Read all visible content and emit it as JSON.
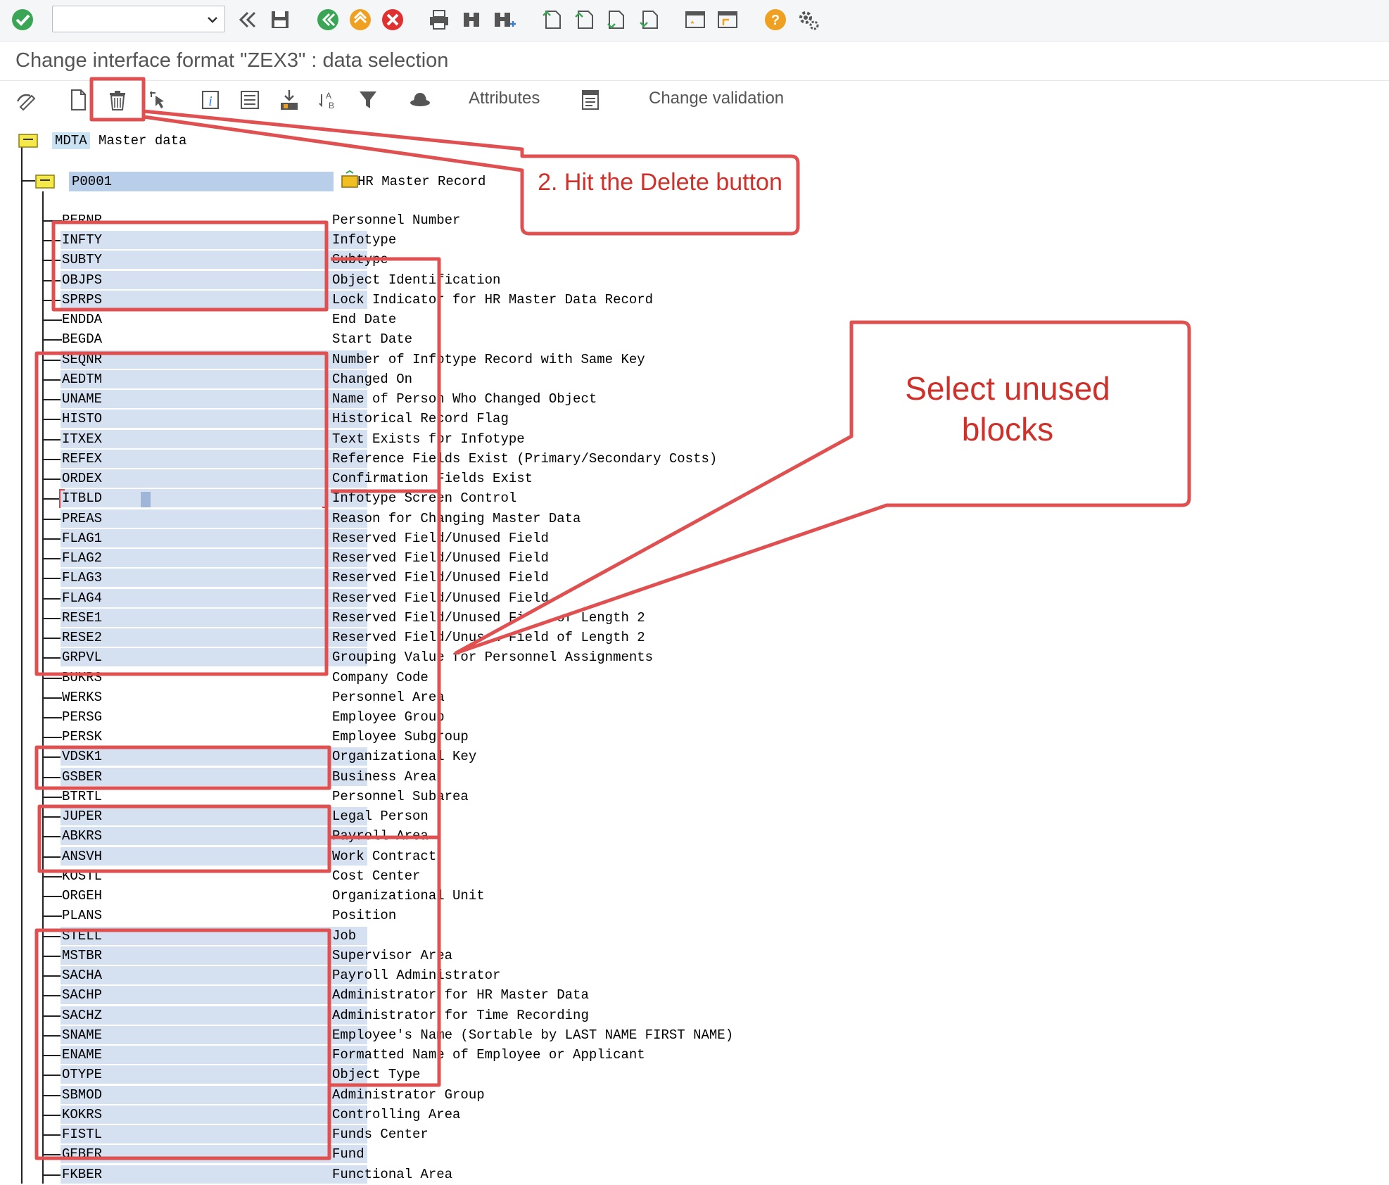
{
  "toolbar": {
    "command_value": "",
    "icons": [
      "enter-icon",
      "back-icon",
      "save-icon",
      "back-green-icon",
      "exit-icon",
      "cancel-icon",
      "print-icon",
      "find-icon",
      "find-next-icon",
      "first-page-icon",
      "previous-page-icon",
      "next-page-icon",
      "last-page-icon",
      "create-session-icon",
      "shortcut-icon",
      "help-icon",
      "settings-icon"
    ]
  },
  "title": "Change interface format \"ZEX3\" : data selection",
  "apptoolbar": {
    "attributes_label": "Attributes",
    "change_validation_label": "Change validation"
  },
  "tree": {
    "root": {
      "key": "MDTA",
      "label": "Master data"
    },
    "segment": {
      "key": "P0001",
      "label": "HR Master Record"
    },
    "fields": [
      {
        "name": "PERNR",
        "desc": "Personnel Number",
        "selected": false
      },
      {
        "name": "INFTY",
        "desc": "Infotype",
        "selected": true
      },
      {
        "name": "SUBTY",
        "desc": "Subtype",
        "selected": true
      },
      {
        "name": "OBJPS",
        "desc": "Object Identification",
        "selected": true
      },
      {
        "name": "SPRPS",
        "desc": "Lock Indicator for HR Master Data Record",
        "selected": true
      },
      {
        "name": "ENDDA",
        "desc": "End Date",
        "selected": false
      },
      {
        "name": "BEGDA",
        "desc": "Start Date",
        "selected": false
      },
      {
        "name": "SEQNR",
        "desc": "Number of Infotype Record with Same Key",
        "selected": true
      },
      {
        "name": "AEDTM",
        "desc": "Changed On",
        "selected": true
      },
      {
        "name": "UNAME",
        "desc": "Name of Person Who Changed Object",
        "selected": true
      },
      {
        "name": "HISTO",
        "desc": "Historical Record Flag",
        "selected": true
      },
      {
        "name": "ITXEX",
        "desc": "Text Exists for Infotype",
        "selected": true
      },
      {
        "name": "REFEX",
        "desc": "Reference Fields Exist (Primary/Secondary Costs)",
        "selected": true
      },
      {
        "name": "ORDEX",
        "desc": "Confirmation Fields Exist",
        "selected": true
      },
      {
        "name": "ITBLD",
        "desc": "Infotype Screen Control",
        "selected": true
      },
      {
        "name": "PREAS",
        "desc": "Reason for Changing Master Data",
        "selected": true
      },
      {
        "name": "FLAG1",
        "desc": "Reserved Field/Unused Field",
        "selected": true
      },
      {
        "name": "FLAG2",
        "desc": "Reserved Field/Unused Field",
        "selected": true
      },
      {
        "name": "FLAG3",
        "desc": "Reserved Field/Unused Field",
        "selected": true
      },
      {
        "name": "FLAG4",
        "desc": "Reserved Field/Unused Field",
        "selected": true
      },
      {
        "name": "RESE1",
        "desc": "Reserved Field/Unused Field of Length 2",
        "selected": true
      },
      {
        "name": "RESE2",
        "desc": "Reserved Field/Unused Field of Length 2",
        "selected": true
      },
      {
        "name": "GRPVL",
        "desc": "Grouping Value for Personnel Assignments",
        "selected": true
      },
      {
        "name": "BUKRS",
        "desc": "Company Code",
        "selected": false
      },
      {
        "name": "WERKS",
        "desc": "Personnel Area",
        "selected": false
      },
      {
        "name": "PERSG",
        "desc": "Employee Group",
        "selected": false
      },
      {
        "name": "PERSK",
        "desc": "Employee Subgroup",
        "selected": false
      },
      {
        "name": "VDSK1",
        "desc": "Organizational Key",
        "selected": true
      },
      {
        "name": "GSBER",
        "desc": "Business Area",
        "selected": true
      },
      {
        "name": "BTRTL",
        "desc": "Personnel Subarea",
        "selected": false
      },
      {
        "name": "JUPER",
        "desc": "Legal Person",
        "selected": true
      },
      {
        "name": "ABKRS",
        "desc": "Payroll Area",
        "selected": true
      },
      {
        "name": "ANSVH",
        "desc": "Work Contract",
        "selected": true
      },
      {
        "name": "KOSTL",
        "desc": "Cost Center",
        "selected": false
      },
      {
        "name": "ORGEH",
        "desc": "Organizational Unit",
        "selected": false
      },
      {
        "name": "PLANS",
        "desc": "Position",
        "selected": false
      },
      {
        "name": "STELL",
        "desc": "Job",
        "selected": true
      },
      {
        "name": "MSTBR",
        "desc": "Supervisor Area",
        "selected": true
      },
      {
        "name": "SACHA",
        "desc": "Payroll Administrator",
        "selected": true
      },
      {
        "name": "SACHP",
        "desc": "Administrator for HR Master Data",
        "selected": true
      },
      {
        "name": "SACHZ",
        "desc": "Administrator for Time Recording",
        "selected": true
      },
      {
        "name": "SNAME",
        "desc": "Employee's Name (Sortable by LAST NAME FIRST NAME)",
        "selected": true
      },
      {
        "name": "ENAME",
        "desc": "Formatted Name of Employee or Applicant",
        "selected": true
      },
      {
        "name": "OTYPE",
        "desc": "Object Type",
        "selected": true
      },
      {
        "name": "SBMOD",
        "desc": "Administrator Group",
        "selected": true
      },
      {
        "name": "KOKRS",
        "desc": "Controlling Area",
        "selected": true
      },
      {
        "name": "FISTL",
        "desc": "Funds Center",
        "selected": true
      },
      {
        "name": "GEBER",
        "desc": "Fund",
        "selected": true
      },
      {
        "name": "FKBER",
        "desc": "Functional Area",
        "selected": true
      }
    ]
  },
  "annotations": {
    "delete_callout": "2. Hit the Delete button",
    "select_callout_line1": "Select unused",
    "select_callout_line2": "blocks",
    "accent_color": "#e05050",
    "text_color": "#d0302a"
  }
}
